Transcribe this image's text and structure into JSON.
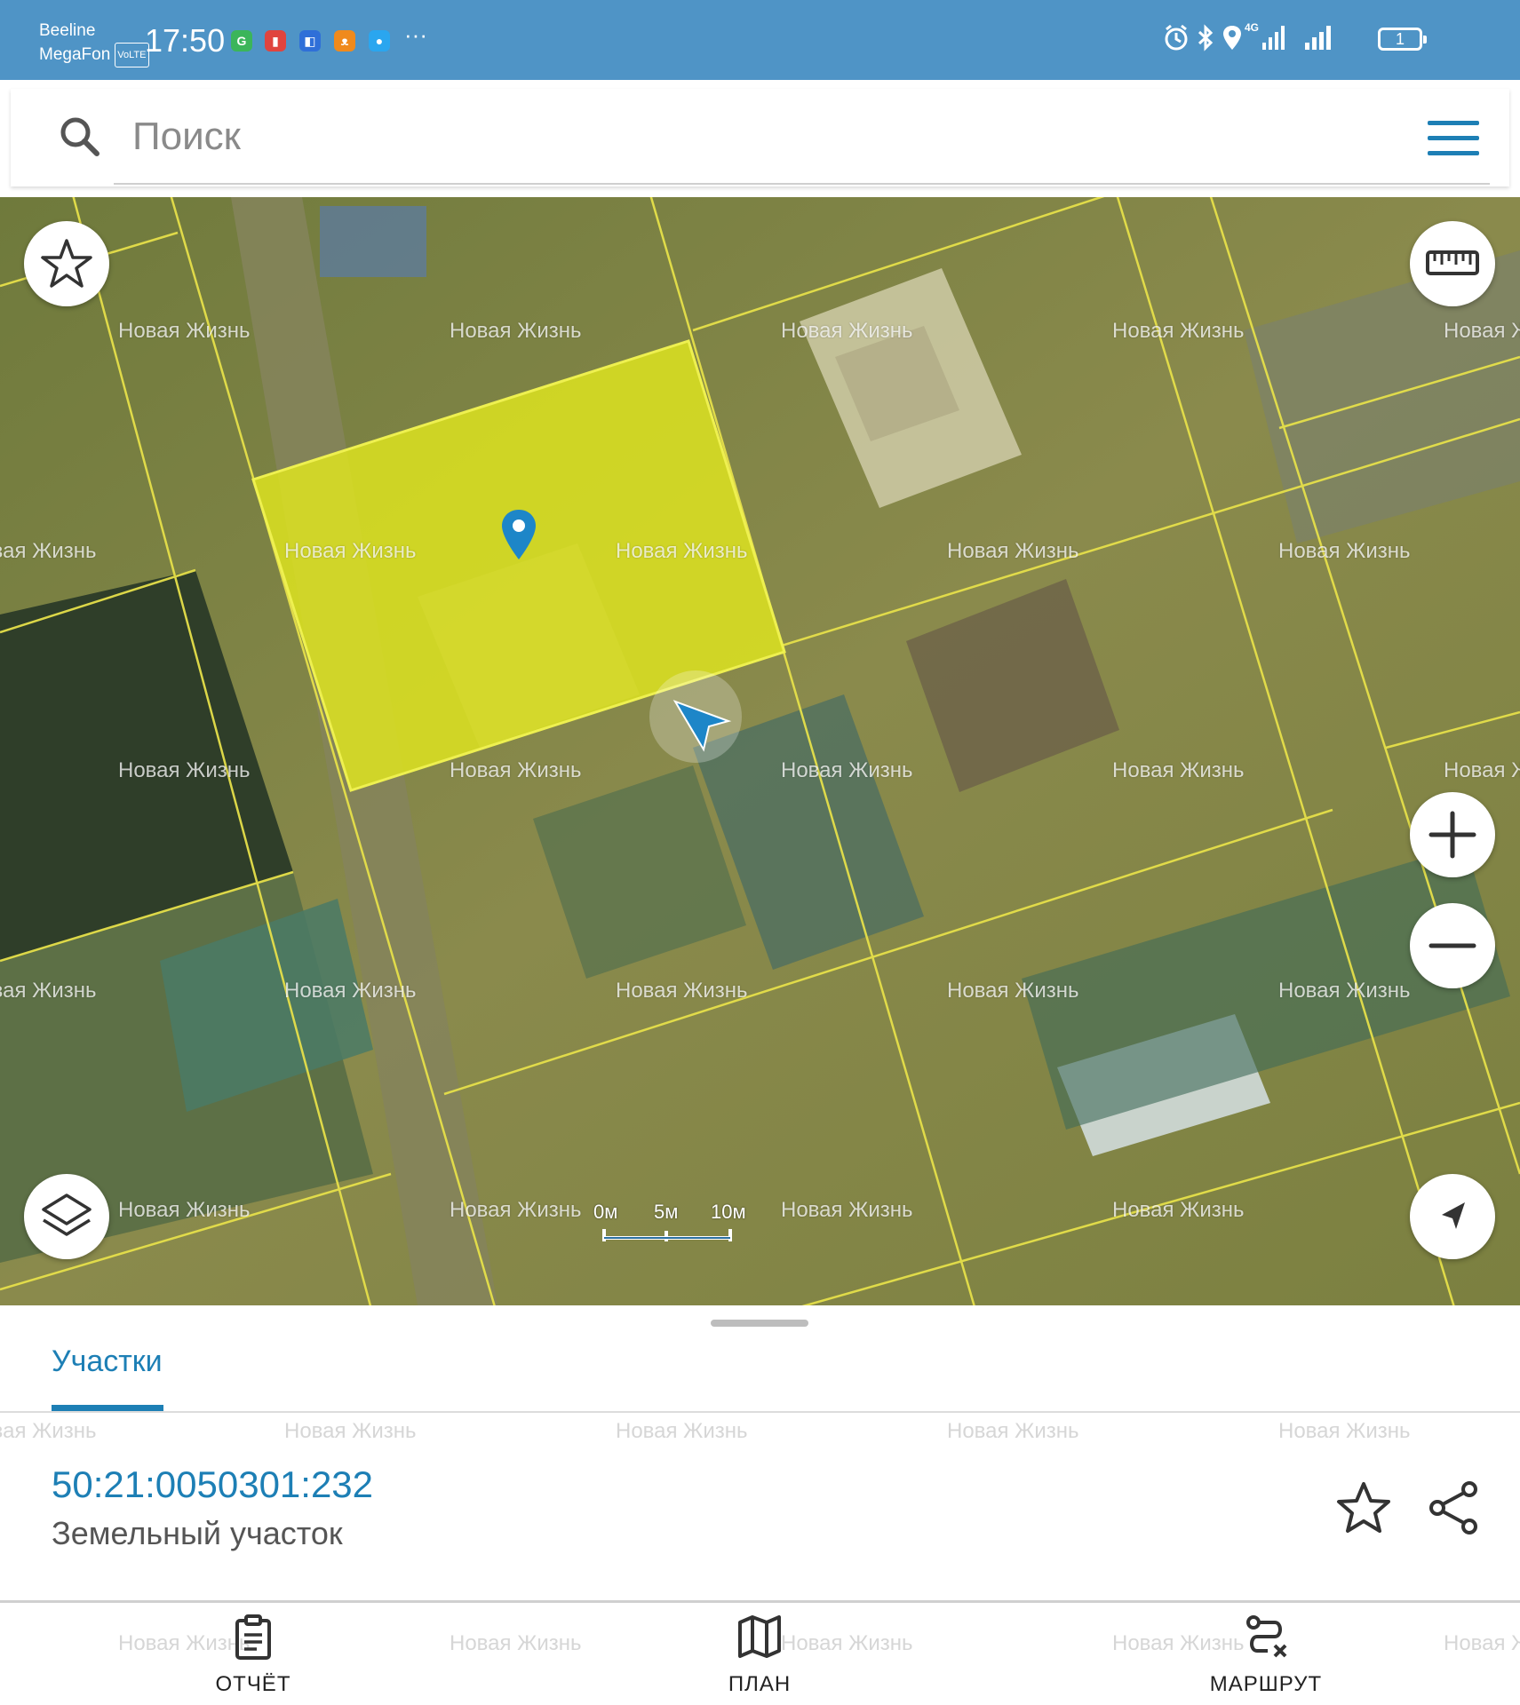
{
  "status_bar": {
    "carrier_1": "Beeline",
    "carrier_2": "MegaFon",
    "volte_badge": "VoLTE",
    "time": "17:50",
    "network": "4G",
    "battery_level": "1",
    "overflow": "···",
    "notification_icons": [
      "green-app-icon",
      "red-app-icon",
      "blue-app-icon",
      "orange-odnoklassniki-icon",
      "blue-chat-icon"
    ]
  },
  "search": {
    "placeholder": "Поиск"
  },
  "map": {
    "watermark": "Новая Жизнь",
    "scale_labels": [
      "0м",
      "5м",
      "10м"
    ],
    "highlight_color": "#e0e61e",
    "boundary_color": "#e6e04a"
  },
  "sheet": {
    "tab_label": "Участки",
    "parcel_number": "50:21:0050301:232",
    "parcel_type": "Земельный участок",
    "watermark": "Новая Жизнь"
  },
  "bottom_nav": {
    "items": [
      {
        "label": "ОТЧЁТ",
        "icon": "clipboard-icon"
      },
      {
        "label": "ПЛАН",
        "icon": "map-icon"
      },
      {
        "label": "МАРШРУТ",
        "icon": "route-icon"
      }
    ],
    "watermark": "Новая Жизнь"
  },
  "colors": {
    "accent": "#1d7fb5",
    "status_bar": "#4f94c6"
  }
}
